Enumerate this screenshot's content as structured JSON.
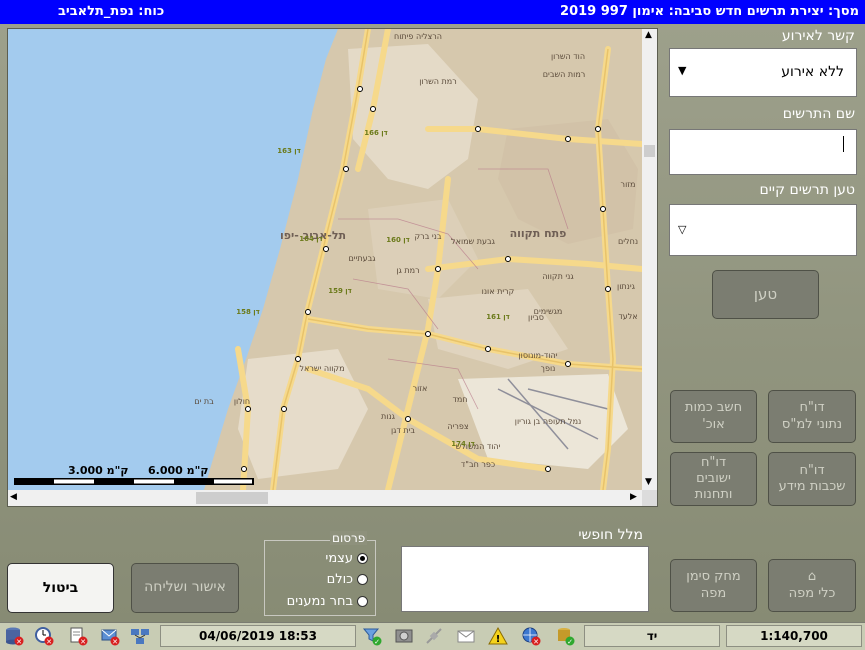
{
  "titlebar": {
    "text_right": "מסך: יצירת תרשים חדש   סביבה: אימון 997 2019",
    "text_left": "כוח: נפת_תלאביב"
  },
  "map": {
    "labels": {
      "city_tlv": "תל-אביב -יפו",
      "city_pt": "פתח תקווה",
      "bnei_brak": "בני ברק",
      "ramat_gan": "רמת גן",
      "givatayim": "גבעתיים",
      "holon": "חולון",
      "bat_yam": "בת ים",
      "yehud": "יהוד-מונוסון",
      "azor": "אזור",
      "savyon": "סביון",
      "givat_shmuel": "גבעת שמואל",
      "kiryat_ono": "קרית אונו",
      "ganei_tikva": "גני תקווה",
      "airport": "נמל תעופה בן גוריון",
      "hod_hasharon": "הוד השרון",
      "ramot_hashavim": "רמות השבים",
      "ramat_hasharon": "רמת השרון",
      "herzliya_pituach": "הרצליה פיתוח",
      "elad": "אלעד",
      "mazor": "מזור",
      "nachalim": "נחלים",
      "mikveh": "מקווה ישראל",
      "yahud_hamoshava": "יהוד המשולש",
      "kfar_chabad": "כפר חב\"ד",
      "beit_dagan": "בית דגן",
      "tzafririm": "צפריה",
      "ganot": "גנות",
      "chemed": "חמד",
      "nofech": "נופך",
      "magshimim": "מגשימים",
      "ginaton": "גינתון",
      "zone_163": "דן 163",
      "zone_164": "דן 164",
      "zone_160": "דן 160",
      "zone_159": "דן 159",
      "zone_158": "דן 158",
      "zone_161": "דן 161",
      "zone_166": "דן 166",
      "zone_174": "דן 174"
    },
    "scale_left": "3.000  ק\"מ",
    "scale_right": "6.000  ק\"מ",
    "colors": {
      "sea": "#a3cbee",
      "land": "#d6c8ad",
      "urban": "#e6dcca",
      "road": "#f6d98b"
    }
  },
  "form": {
    "event_label": "קשר לאירוע",
    "event_value": "ללא אירוע",
    "diagram_name_label": "שם התרשים",
    "diagram_name_value": "",
    "load_existing_label": "טען תרשים קיים",
    "load_existing_value": "",
    "load_button": "טען",
    "free_text_label": "מלל חופשי",
    "free_text_value": ""
  },
  "buttons": {
    "report_to_mds": [
      "דו\"ח",
      "נתוני למ\"ס"
    ],
    "calc_population": [
      "חשב כמות",
      "אוכ'"
    ],
    "layers_report": [
      "דו\"ח",
      "שכבות מידע"
    ],
    "settlements_report": [
      "דו\"ח",
      "ישובים",
      "ותחנות"
    ],
    "map_tools": [
      "⌂",
      "כלי מפה"
    ],
    "erase_map_mark": [
      "מחק סימן",
      "מפה"
    ],
    "approve_send": "אישור ושליחה",
    "cancel": "ביטול"
  },
  "publish": {
    "title": "פרסום",
    "options": [
      "עצמי",
      "כולם",
      "בחר נמענים"
    ],
    "selected": "עצמי"
  },
  "status": {
    "datetime": "04/06/2019 18:53",
    "mode": "יד",
    "scale": "1:140,700"
  }
}
